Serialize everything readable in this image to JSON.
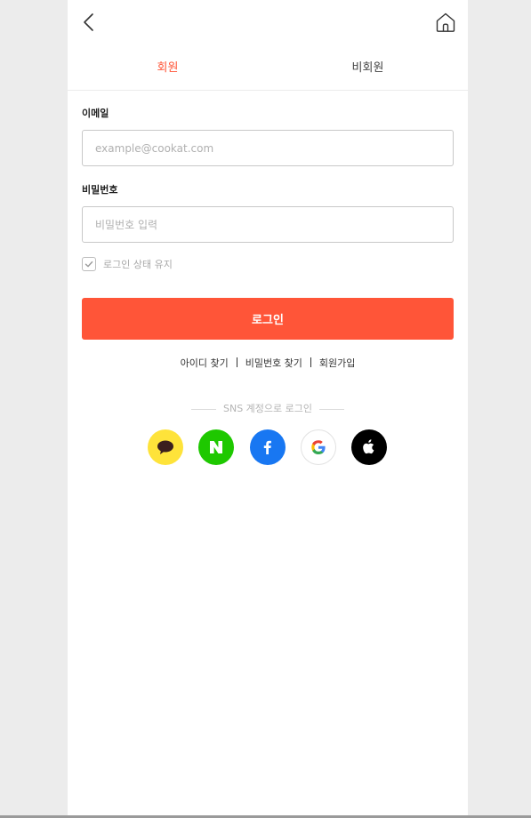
{
  "tabs": {
    "member": "회원",
    "guest": "비회원"
  },
  "email": {
    "label": "이메일",
    "placeholder": "example@cookat.com",
    "value": ""
  },
  "password": {
    "label": "비밀번호",
    "placeholder": "비밀번호 입력",
    "value": ""
  },
  "keep_login": {
    "label": "로그인 상태 유지",
    "checked": true
  },
  "login_button": "로그인",
  "links": {
    "find_id": "아이디 찾기",
    "find_password": "비밀번호 찾기",
    "signup": "회원가입"
  },
  "sns": {
    "title": "SNS 계정으로 로그인",
    "providers": [
      "kakao",
      "naver",
      "facebook",
      "google",
      "apple"
    ]
  },
  "icons": {
    "back": "chevron-left-icon",
    "home": "home-icon"
  },
  "colors": {
    "accent": "#ff5538",
    "kakao": "#fee33a",
    "naver": "#1ec800",
    "facebook": "#1877f2",
    "apple": "#000000"
  }
}
